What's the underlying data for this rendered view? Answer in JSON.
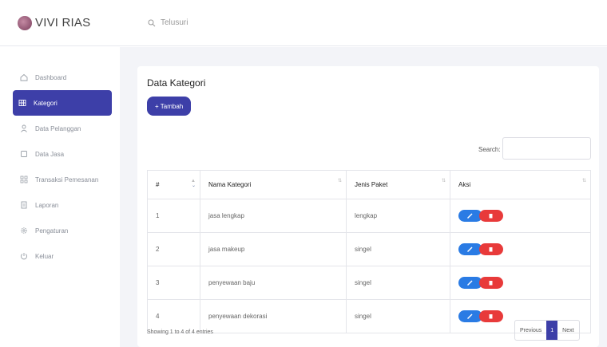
{
  "brand": {
    "name": "VIVI RIAS"
  },
  "header": {
    "search_placeholder": "Telusuri"
  },
  "sidebar": {
    "items": [
      {
        "label": "Dashboard",
        "icon": "home-icon"
      },
      {
        "label": "Kategori",
        "icon": "grid-icon",
        "active": true
      },
      {
        "label": "Data Pelanggan",
        "icon": "user-icon"
      },
      {
        "label": "Data Jasa",
        "icon": "box-icon"
      },
      {
        "label": "Transaksi Pemesanan",
        "icon": "apps-icon"
      },
      {
        "label": "Laporan",
        "icon": "document-icon"
      },
      {
        "label": "Pengaturan",
        "icon": "gear-icon"
      },
      {
        "label": "Keluar",
        "icon": "power-icon"
      }
    ]
  },
  "main": {
    "title": "Data Kategori",
    "add_button": "+ Tambah",
    "search_label": "Search:",
    "table": {
      "headers": [
        "#",
        "Nama Kategori",
        "Jenis Paket",
        "Aksi"
      ],
      "rows": [
        [
          "1",
          "jasa lengkap",
          "lengkap"
        ],
        [
          "2",
          "jasa makeup",
          "singel"
        ],
        [
          "3",
          "penyewaan baju",
          "singel"
        ],
        [
          "4",
          "penyewaan dekorasi",
          "singel"
        ]
      ]
    },
    "info": "Showing 1 to 4 of 4 entries",
    "pagination": {
      "prev": "Previous",
      "current": "1",
      "next": "Next"
    }
  },
  "colors": {
    "primary": "#3d3fa8",
    "edit": "#2a7be4",
    "delete": "#e83a3a"
  }
}
